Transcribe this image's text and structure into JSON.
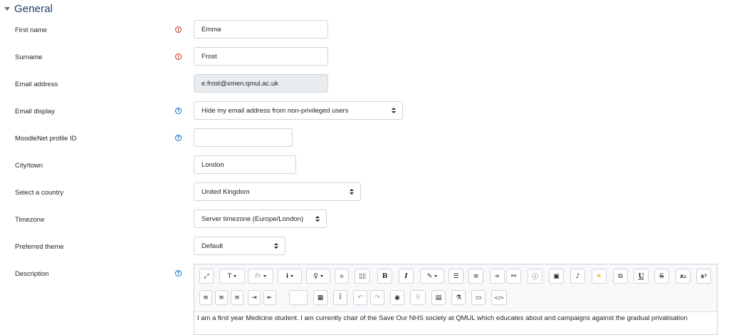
{
  "section": {
    "title": "General"
  },
  "fields": {
    "first_name": {
      "label": "First name",
      "value": "Emma"
    },
    "surname": {
      "label": "Surname",
      "value": "Frost"
    },
    "email": {
      "label": "Email address",
      "value": "e.frost@xmen.qmul.ac.uk"
    },
    "email_display": {
      "label": "Email display",
      "value": "Hide my email address from non-privileged users"
    },
    "moodlenet": {
      "label": "MoodleNet profile ID",
      "value": ""
    },
    "city": {
      "label": "City/town",
      "value": "London"
    },
    "country": {
      "label": "Select a country",
      "value": "United Kingdom"
    },
    "timezone": {
      "label": "Timezone",
      "value": "Server timezone (Europe/London)"
    },
    "theme": {
      "label": "Preferred theme",
      "value": "Default"
    },
    "description": {
      "label": "Description",
      "text": "I am a first year Medicine student. I am currently chair of the Save Our NHS society at QMUL which educates about and campaigns against the gradual privatisation"
    }
  },
  "toolbar": {
    "bold": "B",
    "italic": "I",
    "underline": "U",
    "strike": "S",
    "subscript": "x₂",
    "superscript": "x²",
    "html": "</>",
    "font_size": "T",
    "font_family": "Fr",
    "equation": "Ĩ"
  }
}
